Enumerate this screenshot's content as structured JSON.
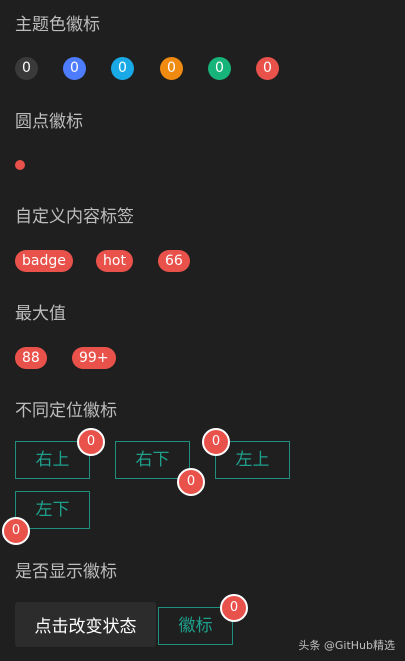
{
  "sections": {
    "theme": "主题色徽标",
    "dot": "圆点徽标",
    "custom": "自定义内容标签",
    "max": "最大值",
    "position": "不同定位徽标",
    "show": "是否显示徽标"
  },
  "theme_badges": [
    {
      "value": "0",
      "color": "#3a3a3a"
    },
    {
      "value": "0",
      "color": "#4d7cfe"
    },
    {
      "value": "0",
      "color": "#19a9e6"
    },
    {
      "value": "0",
      "color": "#f08a10"
    },
    {
      "value": "0",
      "color": "#16b37a"
    },
    {
      "value": "0",
      "color": "#e8524b"
    }
  ],
  "dot_color": "#e8524b",
  "custom_badges": [
    "badge",
    "hot",
    "66"
  ],
  "max_badges": [
    "88",
    "99+"
  ],
  "position_buttons": [
    {
      "label": "右上",
      "badge": "0"
    },
    {
      "label": "右下",
      "badge": "0"
    },
    {
      "label": "左上",
      "badge": "0"
    },
    {
      "label": "左下",
      "badge": "0"
    }
  ],
  "toggle_button": "点击改变状态",
  "badge_button": {
    "label": "徽标",
    "badge": "0"
  },
  "watermark": "头条 @GitHub精选",
  "colors": {
    "accent": "#1fa08d",
    "badge_red": "#e8524b",
    "background": "#1f1f1f"
  }
}
